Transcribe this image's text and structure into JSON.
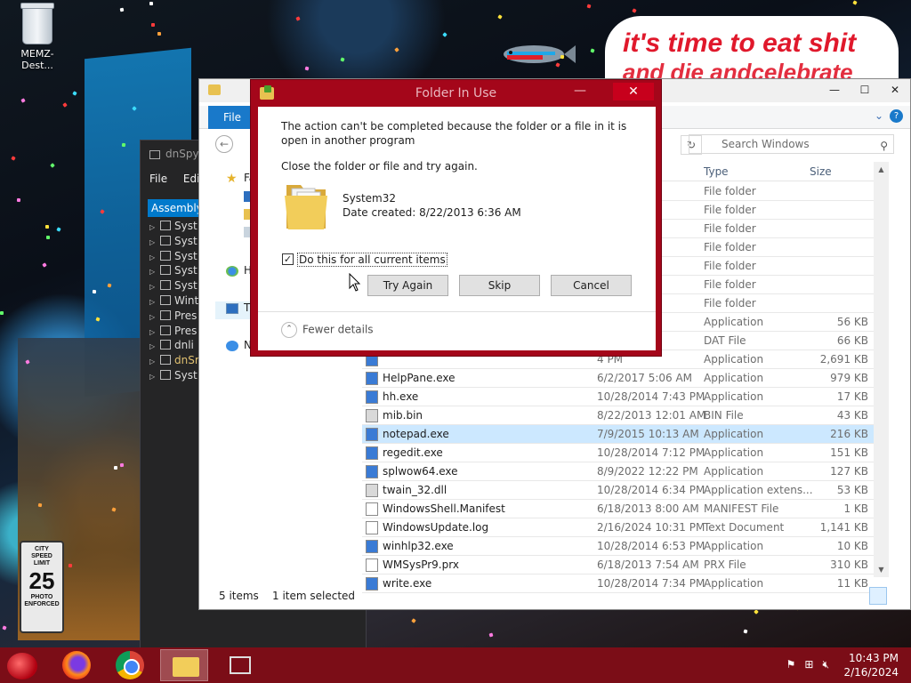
{
  "desktop": {
    "recycle_bin_label": "MEMZ-Dest...",
    "speech_line1": "it's time to eat shit",
    "speech_line2": "and die andcelebrate",
    "sign": {
      "line1": "CITY",
      "line2": "SPEED",
      "line3": "LIMIT",
      "value": "25",
      "line4": "PHOTO",
      "line5": "ENFORCED"
    }
  },
  "dnspy": {
    "title": "dnSpy v",
    "menu": [
      "File",
      "Edit"
    ],
    "panel_tab": "Assembly E",
    "tree": [
      "Syst",
      "Syst",
      "Syst",
      "Syst",
      "Syst",
      "Wint",
      "Pres",
      "Pres",
      "dnli",
      "dnSr",
      "Syst"
    ]
  },
  "explorer": {
    "ribbon": {
      "file_tab": "File"
    },
    "search_placeholder": "Search Windows",
    "nav": [
      {
        "label": "Fa",
        "icon": "star-icon"
      },
      {
        "label": "H",
        "icon": "homegroup-icon"
      },
      {
        "label": "T",
        "icon": "computer-icon"
      },
      {
        "label": "N",
        "icon": "network-icon"
      }
    ],
    "columns": {
      "type": "Type",
      "size": "Size"
    },
    "rows": [
      {
        "name": "",
        "date": "PM",
        "type": "File folder",
        "size": ""
      },
      {
        "name": "",
        "date": "3 AM",
        "type": "File folder",
        "size": ""
      },
      {
        "name": "",
        "date": "2 AM",
        "type": "File folder",
        "size": ""
      },
      {
        "name": "",
        "date": "6 AM",
        "type": "File folder",
        "size": ""
      },
      {
        "name": "",
        "date": "6 AM",
        "type": "File folder",
        "size": ""
      },
      {
        "name": "",
        "date": "2 AM",
        "type": "File folder",
        "size": ""
      },
      {
        "name": "",
        "date": "4 PM",
        "type": "File folder",
        "size": ""
      },
      {
        "name": "",
        "date": "AM",
        "type": "Application",
        "size": "56 KB"
      },
      {
        "name": "",
        "date": "PM",
        "type": "DAT File",
        "size": "66 KB"
      },
      {
        "name": "",
        "date": "4 PM",
        "type": "Application",
        "size": "2,691 KB"
      },
      {
        "name": "HelpPane.exe",
        "date": "6/2/2017 5:06 AM",
        "type": "Application",
        "size": "979 KB"
      },
      {
        "name": "hh.exe",
        "date": "10/28/2014 7:43 PM",
        "type": "Application",
        "size": "17 KB"
      },
      {
        "name": "mib.bin",
        "date": "8/22/2013 12:01 AM",
        "type": "BIN File",
        "size": "43 KB"
      },
      {
        "name": "notepad.exe",
        "date": "7/9/2015 10:13 AM",
        "type": "Application",
        "size": "216 KB"
      },
      {
        "name": "regedit.exe",
        "date": "10/28/2014 7:12 PM",
        "type": "Application",
        "size": "151 KB"
      },
      {
        "name": "splwow64.exe",
        "date": "8/9/2022 12:22 PM",
        "type": "Application",
        "size": "127 KB"
      },
      {
        "name": "twain_32.dll",
        "date": "10/28/2014 6:34 PM",
        "type": "Application extens...",
        "size": "53 KB"
      },
      {
        "name": "WindowsShell.Manifest",
        "date": "6/18/2013 8:00 AM",
        "type": "MANIFEST File",
        "size": "1 KB"
      },
      {
        "name": "WindowsUpdate.log",
        "date": "2/16/2024 10:31 PM",
        "type": "Text Document",
        "size": "1,141 KB"
      },
      {
        "name": "winhlp32.exe",
        "date": "10/28/2014 6:53 PM",
        "type": "Application",
        "size": "10 KB"
      },
      {
        "name": "WMSysPr9.prx",
        "date": "6/18/2013 7:54 AM",
        "type": "PRX File",
        "size": "310 KB"
      },
      {
        "name": "write.exe",
        "date": "10/28/2014 7:34 PM",
        "type": "Application",
        "size": "11 KB"
      }
    ],
    "status": {
      "items": "5 items",
      "selected": "1 item selected"
    }
  },
  "dialog": {
    "title": "Folder In Use",
    "message": "The action can't be completed because the folder or a file in it is open in another program",
    "instruction": "Close the folder or file and try again.",
    "file_name": "System32",
    "file_date": "Date created: 8/22/2013 6:36 AM",
    "checkbox_label": "Do this for all current items",
    "checkbox_checked": true,
    "buttons": {
      "try_again": "Try Again",
      "skip": "Skip",
      "cancel": "Cancel"
    },
    "fewer_details": "Fewer details"
  },
  "taskbar": {
    "time": "10:43 PM",
    "date": "2/16/2024"
  },
  "colors": {
    "dialog_frame": "#a4061a",
    "taskbar": "#7b0d17",
    "accent": "#1979ca",
    "selection": "#cce8ff"
  }
}
